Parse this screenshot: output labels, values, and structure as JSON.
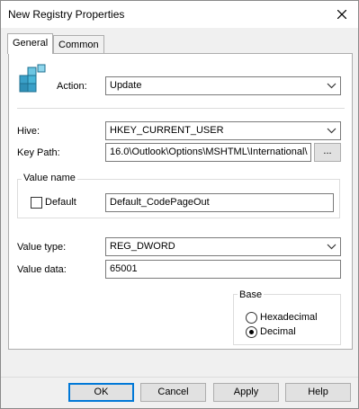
{
  "window": {
    "title": "New Registry Properties"
  },
  "tabs": [
    {
      "label": "General",
      "active": true
    },
    {
      "label": "Common",
      "active": false
    }
  ],
  "icons": {
    "app": "registry-cubes-icon",
    "close": "close-icon",
    "dropdown": "chevron-down-icon"
  },
  "action": {
    "label": "Action:",
    "value": "Update"
  },
  "hive": {
    "label": "Hive:",
    "value": "HKEY_CURRENT_USER"
  },
  "key_path": {
    "label": "Key Path:",
    "value": "16.0\\Outlook\\Options\\MSHTML\\International\\",
    "browse_label": "..."
  },
  "value_name": {
    "group_label": "Value name",
    "default_label": "Default",
    "default_checked": false,
    "value": "Default_CodePageOut"
  },
  "value_type": {
    "label": "Value type:",
    "value": "REG_DWORD"
  },
  "value_data": {
    "label": "Value data:",
    "value": "65001"
  },
  "base": {
    "group_label": "Base",
    "options": [
      {
        "label": "Hexadecimal",
        "selected": false
      },
      {
        "label": "Decimal",
        "selected": true
      }
    ]
  },
  "footer": {
    "ok": "OK",
    "cancel": "Cancel",
    "apply": "Apply",
    "help": "Help"
  }
}
